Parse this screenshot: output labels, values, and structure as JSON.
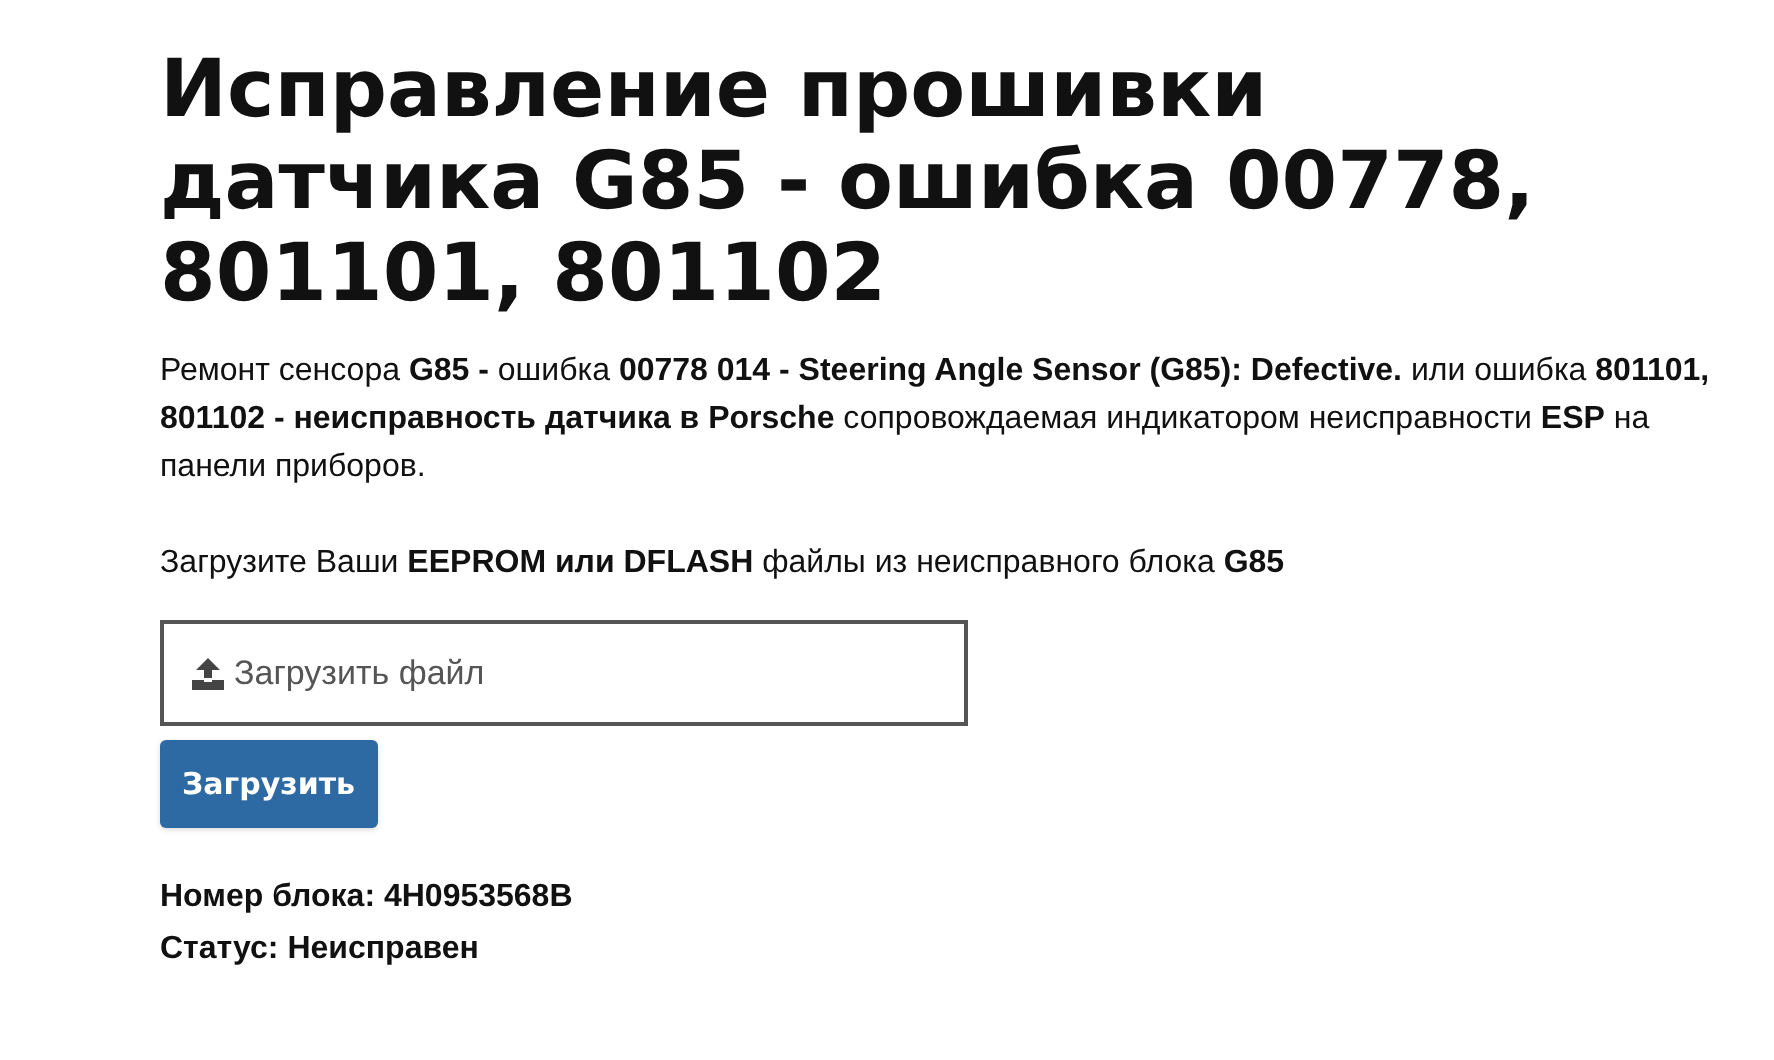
{
  "title": "Исправление прошивки датчика G85 - ошибка 00778, 801101, 801102",
  "description": "Ремонт сенсора **G85 -** ошибка **00778 014 - Steering Angle Sensor (G85): Defective.** или ошибка **801101, 801102 - неисправность датчика в Porsche** сопровождаемая индикатором неисправности **ESP** на панели приборов.",
  "instruction": "Загрузите Ваши **EEPROM или DFLASH** файлы из неисправного блока **G85**",
  "file_field": {
    "placeholder": "Загрузить файл"
  },
  "upload_button": "Загрузить",
  "results": [
    "Номер блока: 4H0953568B",
    "Статус: Неисправен"
  ]
}
